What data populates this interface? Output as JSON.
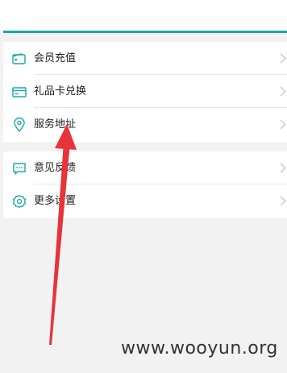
{
  "menu_group_1": [
    {
      "label": "会员充值",
      "icon": "wallet-icon"
    },
    {
      "label": "礼品卡兑换",
      "icon": "gift-card-icon"
    },
    {
      "label": "服务地址",
      "icon": "location-pin-icon"
    }
  ],
  "menu_group_2": [
    {
      "label": "意见反馈",
      "icon": "feedback-chat-icon"
    },
    {
      "label": "更多设置",
      "icon": "settings-gear-icon"
    }
  ],
  "watermark": "www.wooyun.org",
  "colors": {
    "accent": "#1aa7a8",
    "arrow": "#e8333a"
  }
}
